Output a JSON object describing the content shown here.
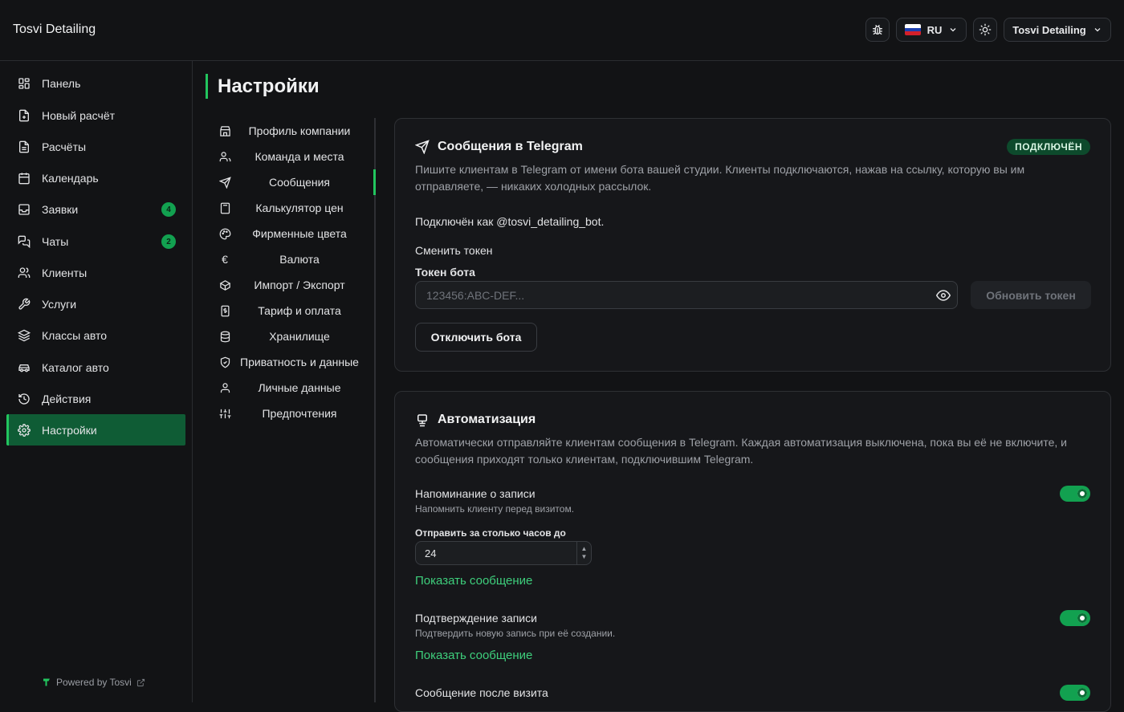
{
  "app": {
    "title": "Tosvi Detailing"
  },
  "header": {
    "language": "RU",
    "account": "Tosvi Detailing"
  },
  "sidebar": {
    "items": [
      {
        "label": "Панель",
        "icon": "dashboard-icon"
      },
      {
        "label": "Новый расчёт",
        "icon": "file-plus-icon"
      },
      {
        "label": "Расчёты",
        "icon": "file-text-icon"
      },
      {
        "label": "Календарь",
        "icon": "calendar-icon"
      },
      {
        "label": "Заявки",
        "icon": "inbox-icon",
        "badge": "4"
      },
      {
        "label": "Чаты",
        "icon": "chat-icon",
        "badge": "2"
      },
      {
        "label": "Клиенты",
        "icon": "users-icon"
      },
      {
        "label": "Услуги",
        "icon": "wrench-icon"
      },
      {
        "label": "Классы авто",
        "icon": "layers-icon"
      },
      {
        "label": "Каталог авто",
        "icon": "car-icon"
      },
      {
        "label": "Действия",
        "icon": "history-icon"
      },
      {
        "label": "Настройки",
        "icon": "gear-icon",
        "active": true
      }
    ],
    "powered": "Powered by Tosvi"
  },
  "page": {
    "title": "Настройки"
  },
  "subnav": {
    "items": [
      {
        "label": "Профиль компании",
        "icon": "store-icon"
      },
      {
        "label": "Команда и места",
        "icon": "team-icon"
      },
      {
        "label": "Сообщения",
        "icon": "send-icon",
        "active": true
      },
      {
        "label": "Калькулятор цен",
        "icon": "calculator-icon"
      },
      {
        "label": "Фирменные цвета",
        "icon": "palette-icon"
      },
      {
        "label": "Валюта",
        "icon": "euro-icon"
      },
      {
        "label": "Импорт / Экспорт",
        "icon": "package-icon"
      },
      {
        "label": "Тариф и оплата",
        "icon": "receipt-icon"
      },
      {
        "label": "Хранилище",
        "icon": "database-icon"
      },
      {
        "label": "Приватность и данные",
        "icon": "shield-icon"
      },
      {
        "label": "Личные данные",
        "icon": "user-icon"
      },
      {
        "label": "Предпочтения",
        "icon": "sliders-icon"
      }
    ]
  },
  "telegram": {
    "title": "Сообщения в Telegram",
    "status": "ПОДКЛЮЧЁН",
    "description": "Пишите клиентам в Telegram от имени бота вашей студии. Клиенты подключаются, нажав на ссылку, которую вы им отправляете, — никаких холодных рассылок.",
    "connected_as": "Подключён как @tosvi_detailing_bot.",
    "change_token": "Сменить токен",
    "token_label": "Токен бота",
    "token_placeholder": "123456:ABC-DEF...",
    "update_button": "Обновить токен",
    "disconnect_button": "Отключить бота"
  },
  "automation": {
    "title": "Автоматизация",
    "description": "Автоматически отправляйте клиентам сообщения в Telegram. Каждая автоматизация выключена, пока вы её не включите, и сообщения приходят только клиентам, подключившим Telegram.",
    "reminder": {
      "title": "Напоминание о записи",
      "subtitle": "Напомнить клиенту перед визитом.",
      "enabled": true,
      "hours_label": "Отправить за столько часов до",
      "hours_value": "24",
      "show_message": "Показать сообщение"
    },
    "confirmation": {
      "title": "Подтверждение записи",
      "subtitle": "Подтвердить новую запись при её создании.",
      "enabled": true,
      "show_message": "Показать сообщение"
    },
    "after_visit": {
      "title": "Сообщение после визита",
      "enabled": true
    }
  },
  "colors": {
    "accent": "#22c55e",
    "active_bg": "#0f5c35",
    "badge": "#12a150"
  }
}
